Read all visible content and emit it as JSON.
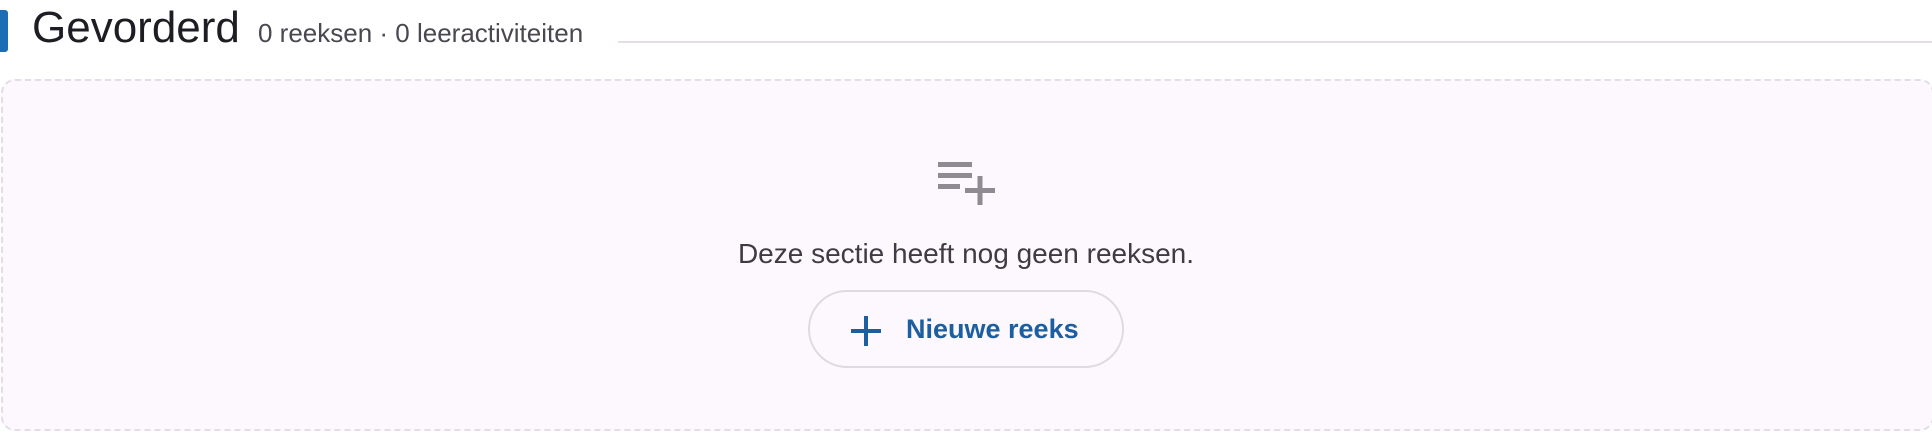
{
  "section": {
    "title": "Gevorderd",
    "meta": "0 reeksen · 0 leeractiviteiten",
    "accent_color": "#1c6db5"
  },
  "empty_state": {
    "icon": "playlist-add-icon",
    "message": "Deze sectie heeft nog geen reeksen."
  },
  "actions": {
    "new_series_label": "Nieuwe reeks",
    "new_series_icon": "plus-icon",
    "button_text_color": "#1c5fa0"
  }
}
